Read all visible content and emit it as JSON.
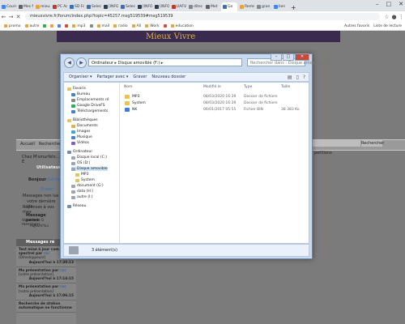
{
  "browser": {
    "tabs": [
      {
        "title": "Cours",
        "color": "#4285f4"
      },
      {
        "title": "Mes f",
        "color": "#5f6368"
      },
      {
        "title": "mieux",
        "color": "#e8a33d"
      },
      {
        "title": "PC Ac",
        "color": "#c0392b"
      },
      {
        "title": "SD Fo",
        "color": "#3b6fb6"
      },
      {
        "title": "Seleci",
        "color": "#3b6fb6"
      },
      {
        "title": "[INFO]",
        "color": "#2c3e50"
      },
      {
        "title": "Seleci",
        "color": "#3b6fb6"
      },
      {
        "title": "[INFO]",
        "color": "#2c3e50"
      },
      {
        "title": "[INFO]",
        "color": "#2c3e50"
      },
      {
        "title": "UAFV",
        "color": "#c0392b"
      },
      {
        "title": "ditec",
        "color": "#7f8c8d"
      },
      {
        "title": "Mot",
        "color": "#5f6368"
      },
      {
        "title": "Ge",
        "color": "#3b6fb6"
      },
      {
        "title": "Reme",
        "color": "#e8a33d"
      },
      {
        "title": "gran",
        "color": "#7f8c8d"
      },
      {
        "title": "lien",
        "color": "#4285f4"
      }
    ],
    "active_tab": 13,
    "new_tab": "+",
    "url": "mieuxvivre.fr/forum/index.php?topic=45257.msg519539#msg519539",
    "bookmarks": [
      {
        "label": "promo",
        "color": "#e8a33d"
      },
      {
        "label": "autre",
        "color": "#e8a33d"
      },
      {
        "label": "",
        "color": "#34a853"
      },
      {
        "label": "",
        "color": "#e8a33d"
      },
      {
        "label": "",
        "color": "#4285f4"
      },
      {
        "label": "",
        "color": "#ea4335"
      },
      {
        "label": "mp3",
        "color": "#e8a33d"
      },
      {
        "label": "",
        "color": "#7f8c8d"
      },
      {
        "label": "mail",
        "color": "#e8a33d"
      },
      {
        "label": "radio",
        "color": "#e8a33d"
      },
      {
        "label": "All",
        "color": "#e8a33d"
      },
      {
        "label": "Work",
        "color": "#e8a33d"
      },
      {
        "label": "",
        "color": "#ea4335"
      },
      {
        "label": "education",
        "color": "#e8a33d"
      }
    ],
    "other_bookmarks": "Autres favoris",
    "reading_list": "Liste de lecture"
  },
  "forum": {
    "banner_text": "Mieux Vivre",
    "nav_left": "Accueil",
    "nav_search_label": "Rechercher",
    "search_button": "Rechercher",
    "welcome_line": "Chez M'smurfelo... E",
    "right_text": "petitions",
    "left_block_title": "Utilisateur",
    "hello": "Bonjour",
    "hello_name": "clubclub",
    "sub_link": "Prefact",
    "messages_lines": [
      "Messages non lus",
      "votre dernière vis",
      "Réponses à vos mes"
    ],
    "personal_title": "Message perso",
    "personal_lines": [
      "Vous avez 0 messages",
      "Aujourd'hui"
    ],
    "recent_title": "Messages ré",
    "recent": [
      {
        "title": "Test mise à jour com avec spectrel par",
        "author": "rioc",
        "section": "[Développeurs]",
        "when": "Aujourd'hui à 17:30:13"
      },
      {
        "title": "Ma présentation par",
        "author": "rioc",
        "section": "[votre présentation]",
        "when": "Aujourd'hui à 17:14:15"
      },
      {
        "title": "Ma présentation par",
        "author": "rioc",
        "section": "[votre présentation]",
        "when": "Aujourd'hui à 17:06:15"
      },
      {
        "title": "Recherche de station automatique ne fonctionne",
        "author": "",
        "section": "",
        "when": ""
      }
    ]
  },
  "explorer": {
    "address": "Ordinateur ▸ Disque amovible (F:) ▸",
    "search_placeholder": "Rechercher dans : Disque amovible (F:)",
    "toolbar": [
      "Organiser ▾",
      "Partager avec ▾",
      "Graver",
      "Nouveau dossier"
    ],
    "tree": [
      {
        "label": "Favoris",
        "level": 0,
        "color": "#e8c54a"
      },
      {
        "label": "Bureau",
        "level": 1,
        "color": "#4a7fc8"
      },
      {
        "label": "Emplacements ré",
        "level": 1,
        "color": "#7f8c8d"
      },
      {
        "label": "Google DriveFS",
        "level": 1,
        "color": "#34a853"
      },
      {
        "label": "Téléchargements",
        "level": 1,
        "color": "#4a7fc8"
      },
      {
        "label": "",
        "level": 0,
        "color": ""
      },
      {
        "label": "Bibliothèques",
        "level": 0,
        "color": "#e8c54a"
      },
      {
        "label": "Documents",
        "level": 1,
        "color": "#d6b25a"
      },
      {
        "label": "Images",
        "level": 1,
        "color": "#4a9fd6"
      },
      {
        "label": "Musique",
        "level": 1,
        "color": "#4a7fc8"
      },
      {
        "label": "Vidéos",
        "level": 1,
        "color": "#7f5fc8"
      },
      {
        "label": "",
        "level": 0,
        "color": ""
      },
      {
        "label": "Ordinateur",
        "level": 0,
        "color": "#6f8fb6"
      },
      {
        "label": "Disque local (C:)",
        "level": 1,
        "color": "#9aa5b1"
      },
      {
        "label": "OS (D:)",
        "level": 1,
        "color": "#9aa5b1"
      },
      {
        "label": "Disque amovible",
        "level": 1,
        "color": "#9aa5b1"
      },
      {
        "label": "MP3",
        "level": 2,
        "color": "#e8c54a"
      },
      {
        "label": "System",
        "level": 2,
        "color": "#e8c54a"
      },
      {
        "label": "document (G:)",
        "level": 1,
        "color": "#9aa5b1"
      },
      {
        "label": "data (H:)",
        "level": 1,
        "color": "#9aa5b1"
      },
      {
        "label": "autre (I:)",
        "level": 1,
        "color": "#9aa5b1"
      },
      {
        "label": "",
        "level": 0,
        "color": ""
      },
      {
        "label": "Réseau",
        "level": 0,
        "color": "#6f8fb6"
      }
    ],
    "selected_tree_index": 15,
    "columns": [
      "Nom",
      "Modifié le",
      "Type",
      "Taille"
    ],
    "files": [
      {
        "name": "MP3",
        "modified": "08/03/2020 16:39",
        "type": "Dossier de fichiers",
        "size": "",
        "color": "#e8c54a"
      },
      {
        "name": "System",
        "modified": "08/03/2020 16:39",
        "type": "Dossier de fichiers",
        "size": "",
        "color": "#e8c54a"
      },
      {
        "name": "NK",
        "modified": "06/01/2017 05:55",
        "type": "Fichier BIN",
        "size": "38 383 Ko",
        "color": "#3b7dd8"
      }
    ],
    "status": "3 élément(s)"
  }
}
